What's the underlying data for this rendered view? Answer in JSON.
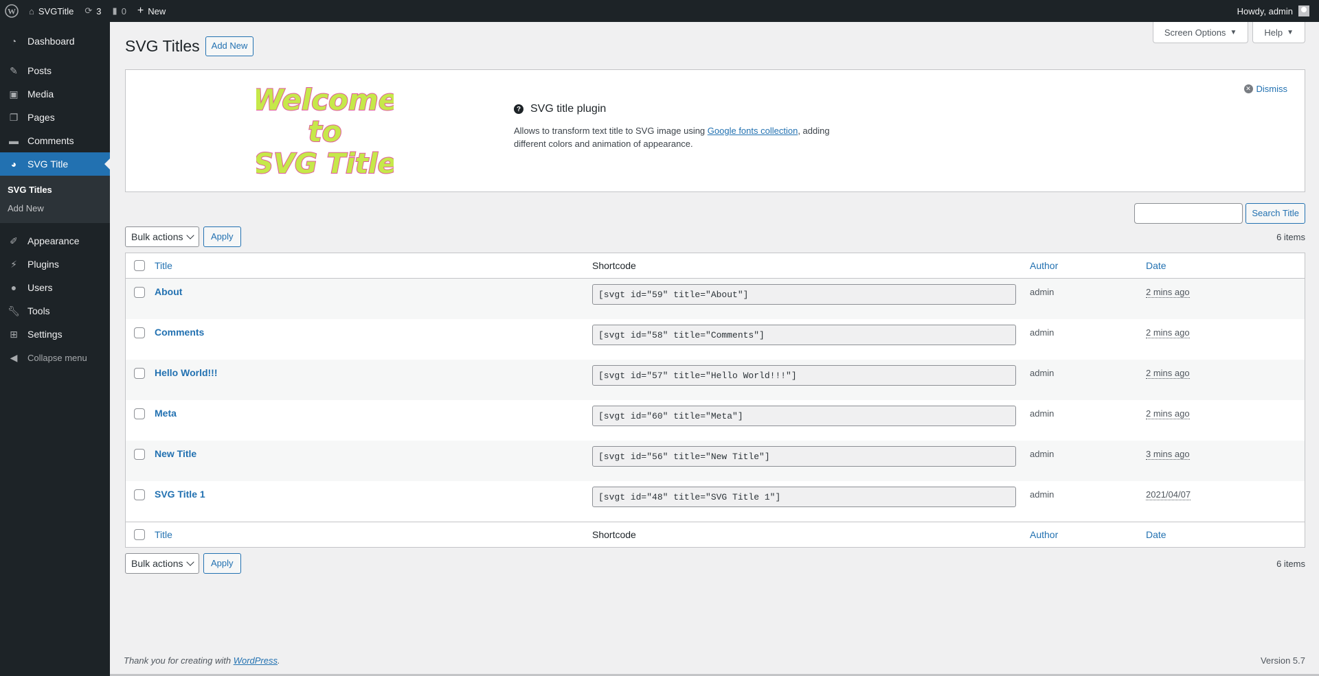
{
  "adminbar": {
    "site_name": "SVGTitle",
    "updates_count": "3",
    "comments_count": "0",
    "new_label": "New",
    "howdy": "Howdy, admin"
  },
  "sidebar": {
    "items": [
      {
        "label": "Dashboard",
        "icon": "dashboard-icon"
      },
      {
        "label": "Posts",
        "icon": "pin-icon"
      },
      {
        "label": "Media",
        "icon": "media-icon"
      },
      {
        "label": "Pages",
        "icon": "pages-icon"
      },
      {
        "label": "Comments",
        "icon": "comments-icon"
      },
      {
        "label": "SVG Title",
        "icon": "svg-title-icon"
      },
      {
        "label": "Appearance",
        "icon": "brush-icon"
      },
      {
        "label": "Plugins",
        "icon": "plugin-icon"
      },
      {
        "label": "Users",
        "icon": "users-icon"
      },
      {
        "label": "Tools",
        "icon": "wrench-icon"
      },
      {
        "label": "Settings",
        "icon": "settings-icon"
      }
    ],
    "submenu": [
      "SVG Titles",
      "Add New"
    ],
    "collapse_label": "Collapse menu"
  },
  "screen_meta": {
    "screen_options": "Screen Options",
    "help": "Help"
  },
  "page": {
    "title": "SVG Titles",
    "add_new": "Add New"
  },
  "notice": {
    "image_lines": [
      "Welcome",
      "to",
      "SVG Title"
    ],
    "title": "SVG title plugin",
    "desc_before": "Allows to transform text title to SVG image using ",
    "desc_link": "Google fonts collection",
    "desc_after": ", adding different colors and animation of appearance.",
    "dismiss": "Dismiss"
  },
  "search": {
    "button": "Search Title",
    "value": ""
  },
  "tablenav": {
    "bulk_actions": "Bulk actions",
    "apply": "Apply",
    "items_count": "6 items"
  },
  "table": {
    "columns": {
      "title": "Title",
      "shortcode": "Shortcode",
      "author": "Author",
      "date": "Date"
    },
    "rows": [
      {
        "title": "About",
        "shortcode": "[svgt id=\"59\" title=\"About\"]",
        "author": "admin",
        "date": "2 mins ago"
      },
      {
        "title": "Comments",
        "shortcode": "[svgt id=\"58\" title=\"Comments\"]",
        "author": "admin",
        "date": "2 mins ago"
      },
      {
        "title": "Hello World!!!",
        "shortcode": "[svgt id=\"57\" title=\"Hello World!!!\"]",
        "author": "admin",
        "date": "2 mins ago"
      },
      {
        "title": "Meta",
        "shortcode": "[svgt id=\"60\" title=\"Meta\"]",
        "author": "admin",
        "date": "2 mins ago"
      },
      {
        "title": "New Title",
        "shortcode": "[svgt id=\"56\" title=\"New Title\"]",
        "author": "admin",
        "date": "3 mins ago"
      },
      {
        "title": "SVG Title 1",
        "shortcode": "[svgt id=\"48\" title=\"SVG Title 1\"]",
        "author": "admin",
        "date": "2021/04/07"
      }
    ]
  },
  "footer": {
    "thanks_before": "Thank you for creating with ",
    "thanks_link": "WordPress",
    "thanks_after": ".",
    "version": "Version 5.7"
  },
  "colors": {
    "accent": "#2271b1",
    "adminbar": "#1d2327",
    "notice_text_fill": "#c6e84a",
    "notice_text_stroke": "#e05a9c"
  }
}
